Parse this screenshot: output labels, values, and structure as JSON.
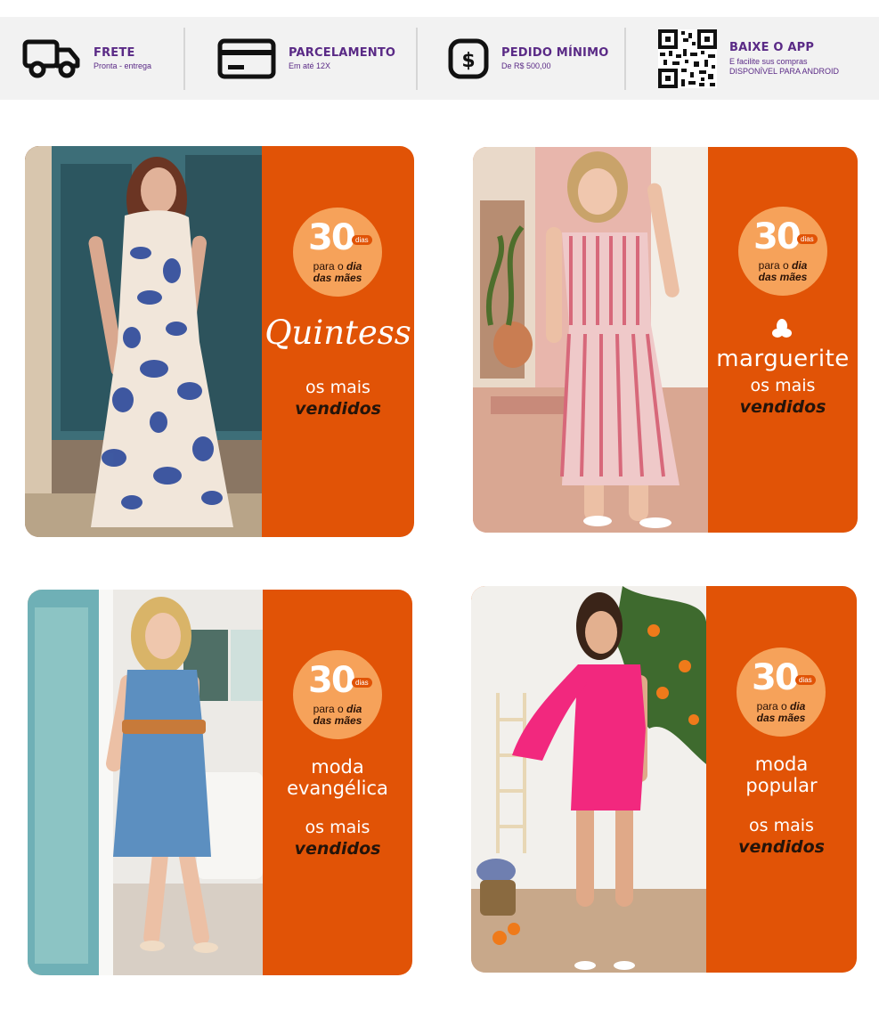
{
  "features": [
    {
      "icon": "truck-icon",
      "title": "FRETE",
      "subtitle": "Pronta - entrega"
    },
    {
      "icon": "credit-card-icon",
      "title": "PARCELAMENTO",
      "subtitle": "Em até 12X"
    },
    {
      "icon": "dollar-icon",
      "title": "PEDIDO MÍNIMO",
      "subtitle": "De R$ 500,00"
    },
    {
      "icon": "qr-code-icon",
      "title": "BAIXE O APP",
      "subtitle": "E facilite sus compras",
      "subtitle2": "DISPONÍVEL PARA ANDROID"
    }
  ],
  "colors": {
    "accent": "#e15306",
    "badge": "#f6a25a",
    "feature_text": "#5a2a86"
  },
  "badge": {
    "number": "30",
    "unit": "dias",
    "line1": "para o",
    "line1_bold": "dia",
    "line2": "das mães"
  },
  "cards": [
    {
      "brand": "Quintess",
      "best1": "os mais",
      "best2": "vendidos"
    },
    {
      "brand": "marguerite",
      "best1": "os mais",
      "best2": "vendidos"
    },
    {
      "category1": "moda",
      "category2": "evangélica",
      "best1": "os mais",
      "best2": "vendidos"
    },
    {
      "category1": "moda",
      "category2": "popular",
      "best1": "os mais",
      "best2": "vendidos"
    }
  ]
}
